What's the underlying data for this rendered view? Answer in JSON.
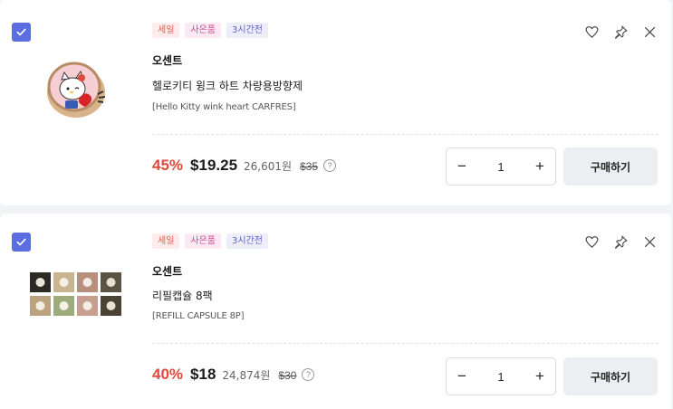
{
  "items": [
    {
      "tags": [
        "세일",
        "사은품",
        "3시간전"
      ],
      "brand": "오센트",
      "name": "헬로키티 윙크 하트 차량용방향제",
      "sub": "[Hello Kitty wink heart CARFRES]",
      "discount": "45%",
      "price": "$19.25",
      "krw": "26,601원",
      "original": "$35",
      "quantity": "1",
      "buy_label": "구매하기",
      "checked": true,
      "thumbnail": "hello-kitty-air-freshener"
    },
    {
      "tags": [
        "세일",
        "사은품",
        "3시간전"
      ],
      "brand": "오센트",
      "name": "리필캡슐 8팩",
      "sub": "[REFILL CAPSULE 8P]",
      "discount": "40%",
      "price": "$18",
      "krw": "24,874원",
      "original": "$30",
      "quantity": "1",
      "buy_label": "구매하기",
      "checked": true,
      "thumbnail": "refill-capsule-grid"
    }
  ],
  "controls": {
    "minus": "−",
    "plus": "+",
    "info": "?"
  },
  "colors": {
    "accent": "#5b6ee1",
    "discount": "#e0483b"
  }
}
